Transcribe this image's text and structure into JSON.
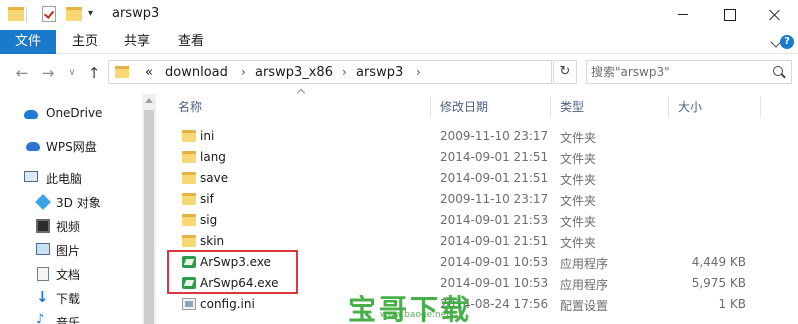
{
  "window": {
    "title": "arswp3"
  },
  "ribbon": {
    "tabs": [
      "文件",
      "主页",
      "共享",
      "查看"
    ],
    "help": "?"
  },
  "address": {
    "crumbs": [
      "«",
      "download",
      "arswp3_x86",
      "arswp3"
    ],
    "search_placeholder": "搜索\"arswp3\""
  },
  "sidebar": {
    "items": [
      {
        "label": "OneDrive",
        "icon": "cloud-icon"
      },
      {
        "label": "WPS网盘",
        "icon": "wps-cloud-icon"
      },
      {
        "label": "此电脑",
        "icon": "computer-icon"
      },
      {
        "label": "3D 对象",
        "icon": "3d-objects-icon"
      },
      {
        "label": "视频",
        "icon": "video-icon"
      },
      {
        "label": "图片",
        "icon": "pictures-icon"
      },
      {
        "label": "文档",
        "icon": "documents-icon"
      },
      {
        "label": "下载",
        "icon": "download-icon"
      },
      {
        "label": "音乐",
        "icon": "music-icon"
      }
    ]
  },
  "columns": {
    "name": "名称",
    "date": "修改日期",
    "type": "类型",
    "size": "大小"
  },
  "files": [
    {
      "name": "ini",
      "date": "2009-11-10 23:17",
      "type": "文件夹",
      "size": "",
      "icon": "folder-icon"
    },
    {
      "name": "lang",
      "date": "2014-09-01 21:51",
      "type": "文件夹",
      "size": "",
      "icon": "folder-icon"
    },
    {
      "name": "save",
      "date": "2014-09-01 21:51",
      "type": "文件夹",
      "size": "",
      "icon": "folder-icon"
    },
    {
      "name": "sif",
      "date": "2009-11-10 23:17",
      "type": "文件夹",
      "size": "",
      "icon": "folder-icon"
    },
    {
      "name": "sig",
      "date": "2014-09-01 21:53",
      "type": "文件夹",
      "size": "",
      "icon": "folder-icon"
    },
    {
      "name": "skin",
      "date": "2014-09-01 21:51",
      "type": "文件夹",
      "size": "",
      "icon": "folder-icon"
    },
    {
      "name": "ArSwp3.exe",
      "date": "2014-09-01 10:53",
      "type": "应用程序",
      "size": "4,449 KB",
      "icon": "exe-icon"
    },
    {
      "name": "ArSwp64.exe",
      "date": "2014-09-01 10:53",
      "type": "应用程序",
      "size": "5,975 KB",
      "icon": "exe-icon"
    },
    {
      "name": "config.ini",
      "date": "2014-08-24 17:56",
      "type": "配置设置",
      "size": "1 KB",
      "icon": "ini-file-icon"
    }
  ],
  "watermark": {
    "text": "宝哥下载",
    "url": "www.baoge.net"
  },
  "colors": {
    "accent": "#1979ca",
    "highlight_border": "#d9363e",
    "watermark": "#3aa93b"
  }
}
